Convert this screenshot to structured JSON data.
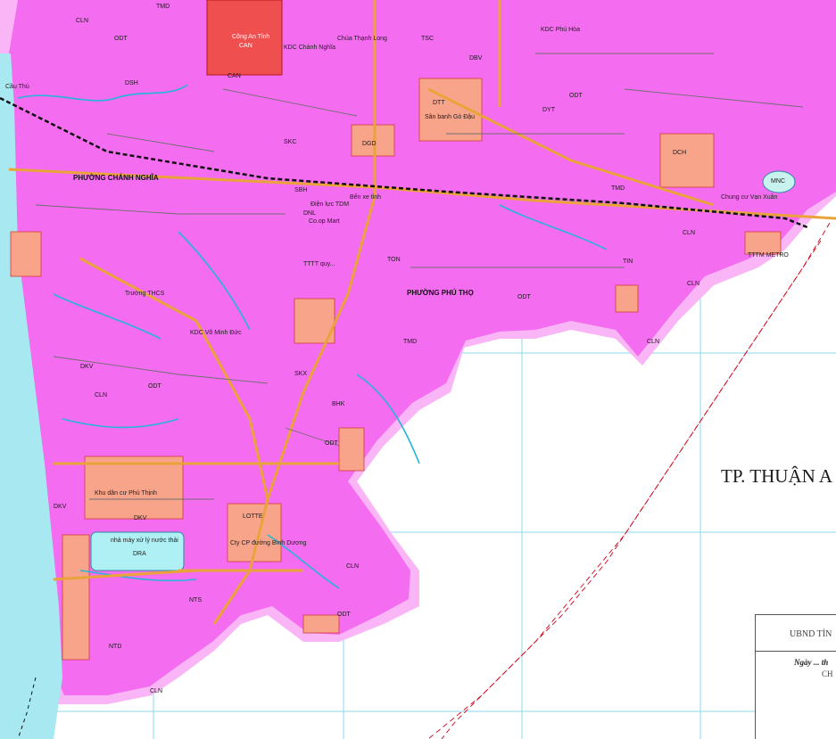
{
  "map": {
    "city_label": "TP. THUẬN A",
    "legend": {
      "org": "UBND TỈN",
      "date": "Ngày ... th",
      "sub": "CH"
    },
    "colors": {
      "residential": "#f46df0",
      "commercial": "#f7a48a",
      "river": "#a8e8f0",
      "water_plant": "#aef0f4",
      "police": "#ef4f4f",
      "grid": "#54c7df",
      "road": "#e9a33a",
      "halo": "#f9b5f5"
    },
    "wards": [
      "PHƯỜNG CHÁNH NGHĨA",
      "PHƯỜNG PHÚ THỌ"
    ],
    "landmarks": {
      "police": "Công An Tỉnh",
      "police_code": "CAN",
      "kdc_chanh_nghia": "KDC Chánh Nghĩa",
      "kdc_phu_hoa": "KDC Phú Hòa",
      "chua_thanh_long": "Chùa Thạnh Long",
      "san_banh": "Sân banh Gò Đậu",
      "lotte": "LOTTE",
      "metro": "TTTM METRO",
      "water_plant": "nhà máy xử lý nước thải",
      "water_plant_code": "DRA",
      "kdc_vo_minh_duc": "KDC Võ Minh Đức",
      "chung_cu_van_xuan": "Chung cư Vạn Xuân",
      "cau_thu": "Cầu Thủ",
      "khu_dan_cu_phu_thinh": "Khu dân cư Phú Thịnh",
      "cty_cp_duong": "Cty CP đường Bình Dương",
      "ben_xe_tinh": "Bến xe tỉnh",
      "dien_luc_tdm": "Điện lực TDM",
      "truong_thcs": "Trường THCS",
      "co_op_mart": "Co.op Mart",
      "ttvh": "TTTT quy...",
      "sbh": "SBH"
    },
    "codes": [
      "ODT",
      "TMD",
      "CLN",
      "DGD",
      "SKC",
      "TON",
      "DKV",
      "DSH",
      "TSC",
      "DBV",
      "DTT",
      "CAN",
      "BHK",
      "TIN",
      "DCH",
      "DYT",
      "NTS",
      "NTD",
      "MNC",
      "DNL",
      "SKX"
    ]
  }
}
